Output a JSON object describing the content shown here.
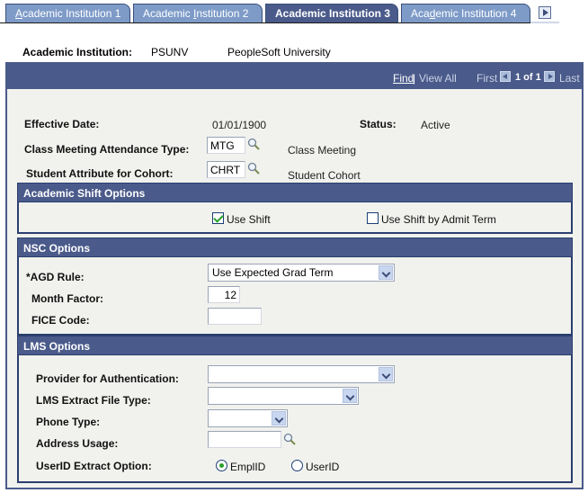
{
  "tabs": [
    {
      "label": "Academic Institution 1",
      "accesskey_index": 0,
      "active": false
    },
    {
      "label": "Academic Institution 2",
      "accesskey_index": 9,
      "active": false
    },
    {
      "label": "Academic Institution 3",
      "active": true
    },
    {
      "label": "Academic Institution 4",
      "accesskey_index": 3,
      "active": false
    }
  ],
  "header": {
    "label": "Academic Institution:",
    "code": "PSUNV",
    "name": "PeopleSoft University"
  },
  "navigation": {
    "find": "Find",
    "separator": "|",
    "view_all": "View All",
    "first": "First",
    "count": "1 of 1",
    "last": "Last"
  },
  "fields": {
    "effective_date_label": "Effective Date:",
    "effective_date": "01/01/1900",
    "status_label": "Status:",
    "status": "Active",
    "class_meeting_label": "Class Meeting Attendance Type:",
    "class_meeting_value": "MTG",
    "class_meeting_desc": "Class Meeting",
    "student_attr_label": "Student Attribute for Cohort:",
    "student_attr_value": "CHRT",
    "student_attr_desc": "Student Cohort"
  },
  "academic_shift": {
    "title": "Academic Shift Options",
    "use_shift_label": "Use Shift",
    "use_shift_checked": true,
    "use_shift_admit_label": "Use Shift by Admit Term",
    "use_shift_admit_checked": false
  },
  "nsc": {
    "title": "NSC Options",
    "agd_rule_label": "*AGD Rule:",
    "agd_rule_value": "Use Expected Grad Term",
    "month_factor_label": "Month Factor:",
    "month_factor_value": "12",
    "fice_code_label": "FICE Code:",
    "fice_code_value": ""
  },
  "lms": {
    "title": "LMS Options",
    "provider_label": "Provider for Authentication:",
    "provider_value": "",
    "extract_file_label": "LMS Extract File Type:",
    "extract_file_value": "",
    "phone_type_label": "Phone Type:",
    "phone_type_value": "",
    "address_usage_label": "Address Usage:",
    "address_usage_value": "",
    "userid_option_label": "UserID Extract Option:",
    "option_emplid": "EmplID",
    "option_userid": "UserID",
    "selected_option": "EmplID"
  }
}
